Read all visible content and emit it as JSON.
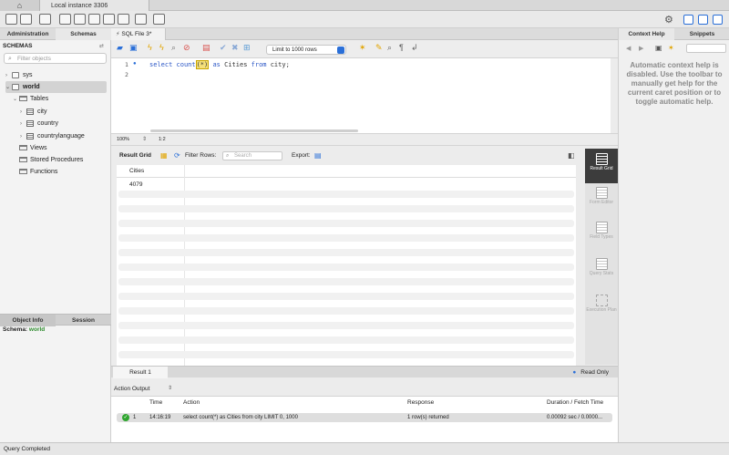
{
  "top_tabs": {
    "instance": "Local instance 3306"
  },
  "sidebar": {
    "tabs": [
      "Administration",
      "Schemas"
    ],
    "header": "SCHEMAS",
    "filter_placeholder": "Filter objects",
    "tree": {
      "sys": "sys",
      "world": "world",
      "tables": "Tables",
      "table_items": [
        "city",
        "country",
        "countrylanguage"
      ],
      "views": "Views",
      "procedures": "Stored Procedures",
      "functions": "Functions"
    },
    "bottom_tabs": [
      "Object Info",
      "Session"
    ],
    "schema_label": "Schema:",
    "schema_value": "world"
  },
  "editor": {
    "tab_label": "SQL File 3*",
    "limit_select": "Limit to 1000 rows",
    "line_numbers": [
      "1",
      "2"
    ],
    "code": {
      "kw_select": "select",
      "fn": "count",
      "arg": "(*)",
      "kw_as": "as",
      "alias": "Cities",
      "kw_from": "from",
      "table": "city;"
    },
    "zoom": "100%",
    "cursor_pos": "1:2"
  },
  "result": {
    "label": "Result Grid",
    "filter_label": "Filter Rows:",
    "search_placeholder": "Search",
    "export_label": "Export:",
    "columns": [
      "Cities"
    ],
    "rows": [
      [
        "4079"
      ]
    ],
    "tab": "Result 1",
    "readonly": "Read Only",
    "side_panel": [
      "Result Grid",
      "Form Editor",
      "Field Types",
      "Query Stats",
      "Execution Plan"
    ]
  },
  "action_output": {
    "label": "Action Output",
    "columns": [
      "Time",
      "Action",
      "Response",
      "Duration / Fetch Time"
    ],
    "rows": [
      {
        "index": "1",
        "time": "14:16:19",
        "action": "select count(*) as Cities from city LIMIT 0, 1000",
        "response": "1 row(s) returned",
        "duration": "0.00092 sec / 0.0000..."
      }
    ]
  },
  "right_panel": {
    "tabs": [
      "Context Help",
      "Snippets"
    ],
    "help_text": "Automatic context help is disabled. Use the toolbar to manually get help for the current caret position or to toggle automatic help."
  },
  "status": "Query Completed",
  "colors": {
    "accent": "#2a6fd8",
    "success": "#2fa52f",
    "keyword": "#2a56c6"
  }
}
